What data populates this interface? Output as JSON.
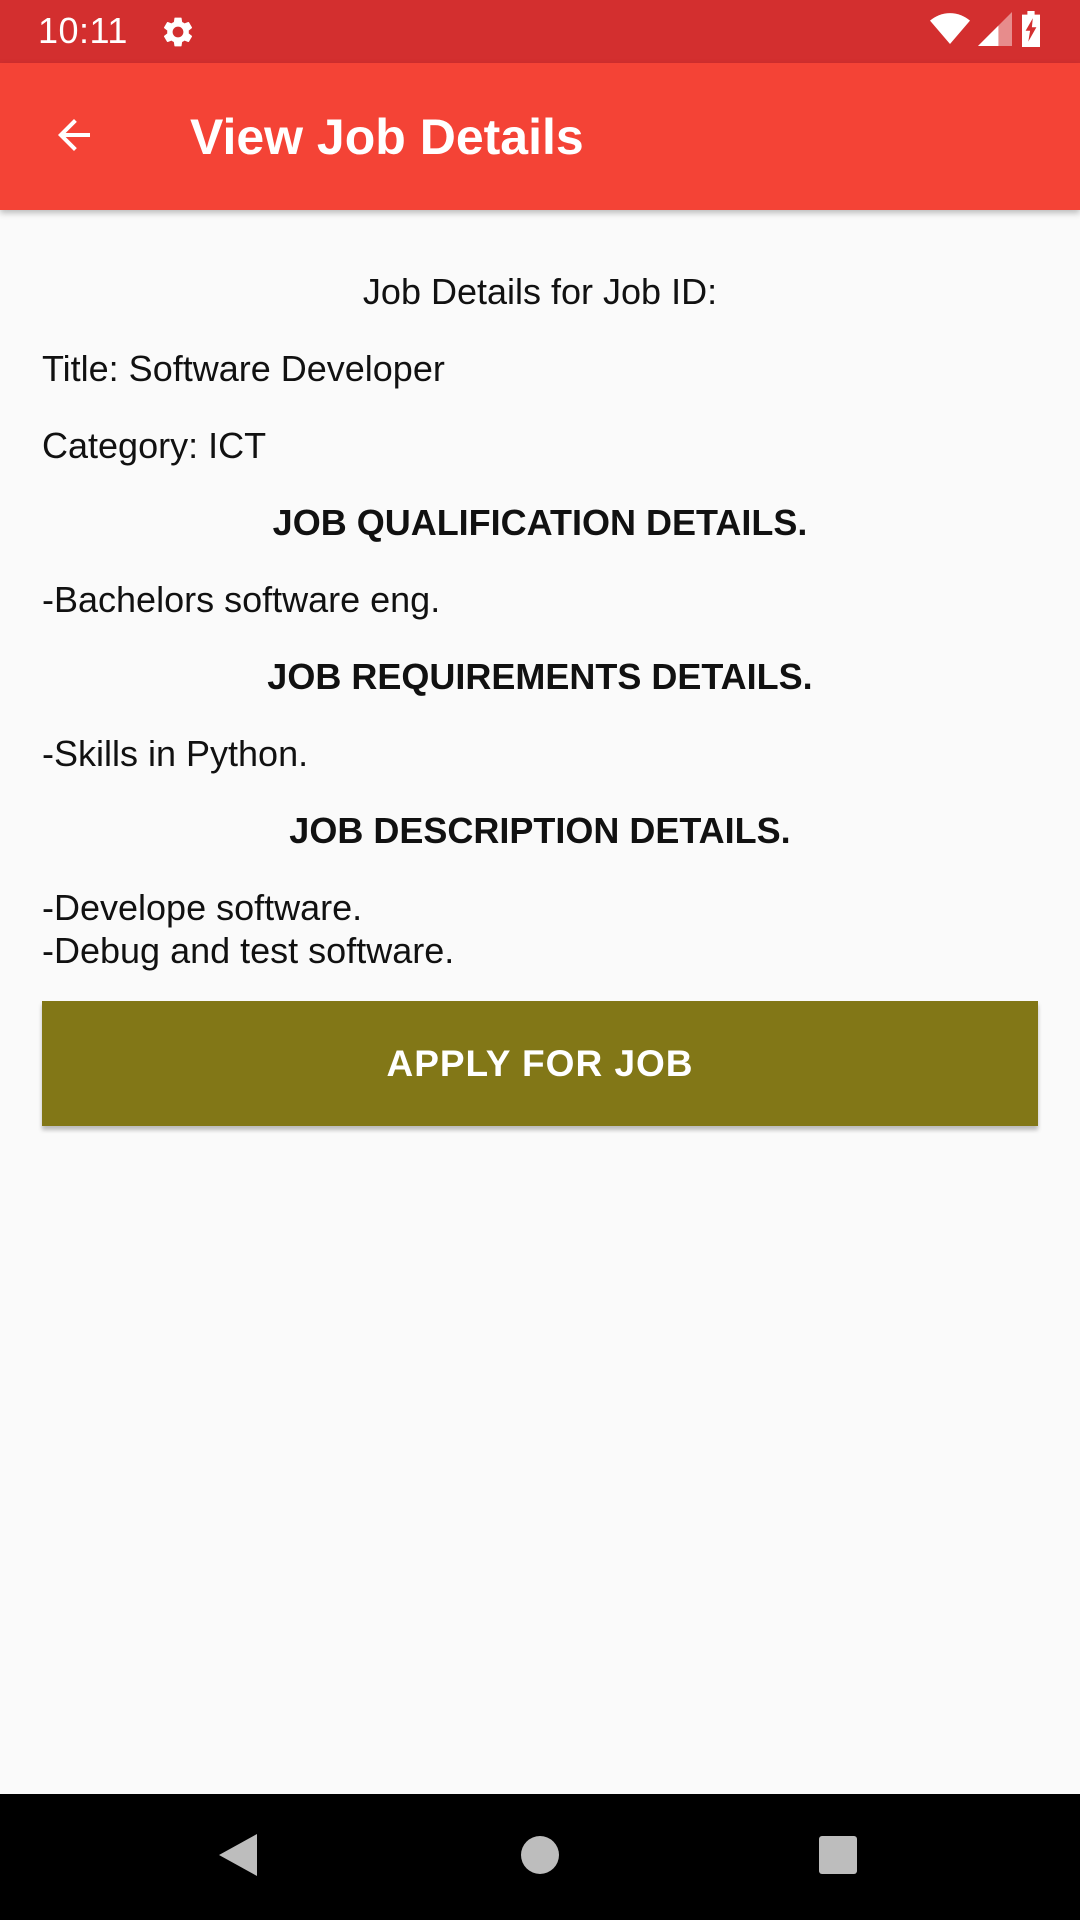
{
  "status_bar": {
    "time": "10:11",
    "icons": [
      "settings-icon",
      "wifi-icon",
      "cellular-signal-icon",
      "battery-charging-icon"
    ]
  },
  "app_bar": {
    "title": "View Job Details",
    "back_icon": "arrow-back-icon"
  },
  "job": {
    "header": "Job Details for Job ID:",
    "title": "Title: Software Developer",
    "category": "Category: ICT",
    "qualification_heading": "JOB QUALIFICATION DETAILS.",
    "qualification": "-Bachelors software eng.",
    "requirements_heading": "JOB REQUIREMENTS DETAILS.",
    "requirements": "-Skills in Python.",
    "description_heading": "JOB DESCRIPTION DETAILS.",
    "description_lines": [
      "-Develope software.",
      "-Debug and test software."
    ]
  },
  "actions": {
    "apply_label": "APPLY FOR JOB"
  },
  "nav_bar": {
    "icons": [
      "back-triangle-icon",
      "home-circle-icon",
      "recents-square-icon"
    ]
  },
  "colors": {
    "status_bar": "#d32f2f",
    "app_bar": "#f44336",
    "apply_button": "#827717",
    "background": "#fafafa"
  }
}
